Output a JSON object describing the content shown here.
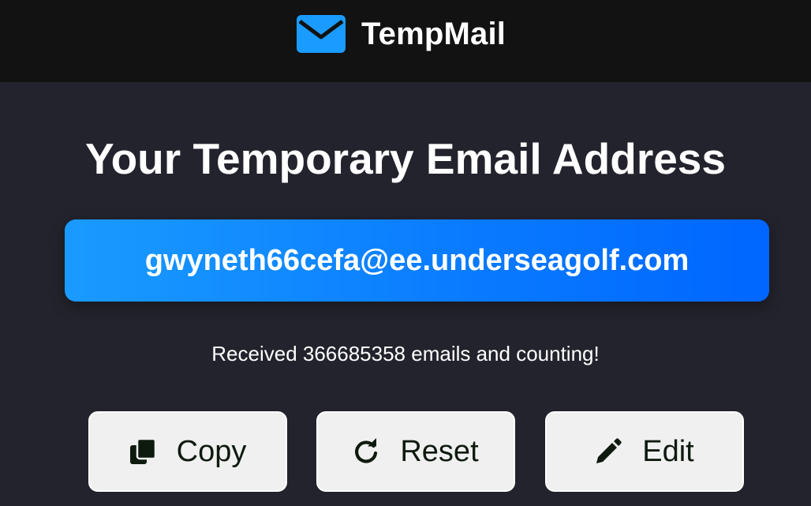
{
  "header": {
    "brand_name": "TempMail",
    "logo_icon": "envelope-icon",
    "logo_color": "#1a9bff"
  },
  "main": {
    "title": "Your Temporary Email Address",
    "email_address": "gwyneth66cefa@ee.underseagolf.com",
    "counter_text": "Received 366685358 emails and counting!"
  },
  "actions": {
    "copy": {
      "label": "Copy",
      "icon": "copy-icon"
    },
    "reset": {
      "label": "Reset",
      "icon": "refresh-icon"
    },
    "edit": {
      "label": "Edit",
      "icon": "pencil-icon"
    }
  },
  "colors": {
    "background": "#23232d",
    "topbar": "#121212",
    "accent_start": "#1a9bff",
    "accent_end": "#0066ff",
    "button_bg": "#f0f0f0"
  }
}
